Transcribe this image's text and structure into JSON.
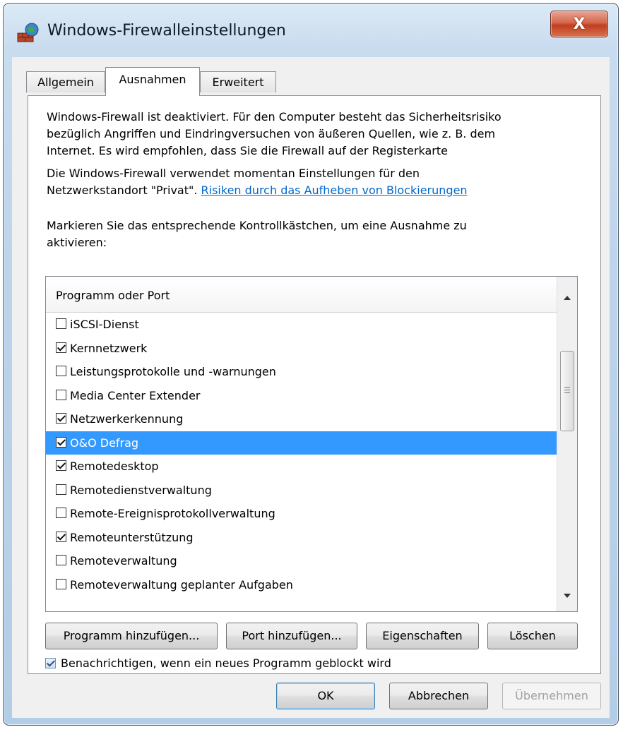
{
  "window": {
    "title": "Windows-Firewalleinstellungen",
    "close_label": "X"
  },
  "tabs": [
    {
      "label": "Allgemein",
      "active": false
    },
    {
      "label": "Ausnahmen",
      "active": true
    },
    {
      "label": "Erweitert",
      "active": false
    }
  ],
  "description": {
    "line1": "Windows-Firewall ist deaktiviert. Für den Computer besteht das Sicherheitsrisiko",
    "line2": "bezüglich Angriffen und Eindringversuchen von äußeren Quellen, wie z. B. dem",
    "line3": "Internet. Es wird empfohlen, dass Sie die Firewall auf der Registerkarte",
    "line4": "Die Windows-Firewall verwendet momentan Einstellungen für den",
    "line5_prefix": "Netzwerkstandort \"Privat\". ",
    "link": "Risiken durch das Aufheben von Blockierungen"
  },
  "instruction": {
    "line1": "Markieren Sie das entsprechende Kontrollkästchen, um eine Ausnahme zu",
    "line2": "aktivieren:"
  },
  "list": {
    "header": "Programm oder Port",
    "items": [
      {
        "label": "iSCSI-Dienst",
        "checked": false,
        "selected": false
      },
      {
        "label": "Kernnetzwerk",
        "checked": true,
        "selected": false
      },
      {
        "label": "Leistungsprotokolle und -warnungen",
        "checked": false,
        "selected": false
      },
      {
        "label": "Media Center Extender",
        "checked": false,
        "selected": false
      },
      {
        "label": "Netzwerkerkennung",
        "checked": true,
        "selected": false
      },
      {
        "label": "O&O Defrag",
        "checked": true,
        "selected": true
      },
      {
        "label": "Remotedesktop",
        "checked": true,
        "selected": false
      },
      {
        "label": "Remotedienstverwaltung",
        "checked": false,
        "selected": false
      },
      {
        "label": "Remote-Ereignisprotokollverwaltung",
        "checked": false,
        "selected": false
      },
      {
        "label": "Remoteunterstützung",
        "checked": true,
        "selected": false
      },
      {
        "label": "Remoteverwaltung",
        "checked": false,
        "selected": false
      },
      {
        "label": "Remoteverwaltung geplanter Aufgaben",
        "checked": false,
        "selected": false
      }
    ]
  },
  "actions": {
    "add_program": "Programm hinzufügen...",
    "add_port": "Port hinzufügen...",
    "properties": "Eigenschaften",
    "delete": "Löschen"
  },
  "notify": {
    "label": "Benachrichtigen, wenn ein neues Programm geblockt wird",
    "checked": true
  },
  "footer": {
    "ok": "OK",
    "cancel": "Abbrechen",
    "apply": "Übernehmen"
  },
  "colors": {
    "selection": "#3399ff",
    "link": "#0066cc",
    "close": "#c13e20"
  }
}
